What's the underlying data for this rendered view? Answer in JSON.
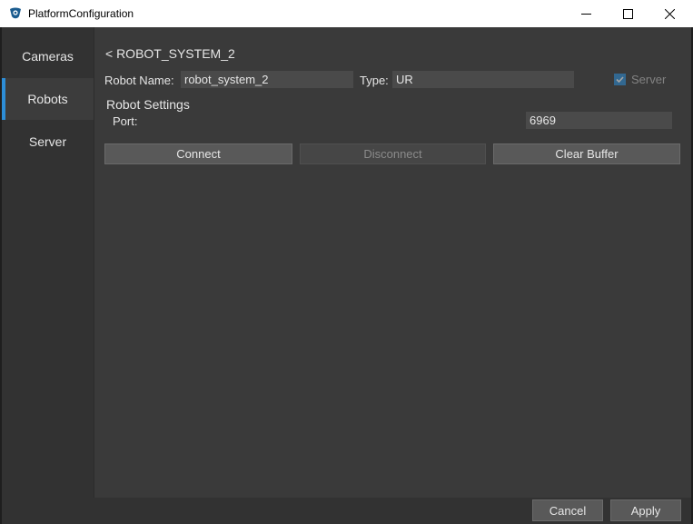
{
  "window": {
    "title": "PlatformConfiguration",
    "controls": {
      "minimize": "minimize-icon",
      "maximize": "maximize-icon",
      "close": "close-icon"
    }
  },
  "sidebar": {
    "items": [
      {
        "label": "Cameras",
        "active": false
      },
      {
        "label": "Robots",
        "active": true
      },
      {
        "label": "Server",
        "active": false
      }
    ]
  },
  "main": {
    "back_link": "< ROBOT_SYSTEM_2",
    "robot_name_label": "Robot Name:",
    "robot_name_value": "robot_system_2",
    "type_label": "Type:",
    "type_value": "UR",
    "server_checkbox": {
      "label": "Server",
      "checked": true,
      "enabled": false
    },
    "settings_title": "Robot Settings",
    "port_label": "Port:",
    "port_value": "6969",
    "buttons": {
      "connect": "Connect",
      "disconnect": "Disconnect",
      "clear_buffer": "Clear Buffer"
    }
  },
  "footer": {
    "cancel": "Cancel",
    "apply": "Apply"
  },
  "colors": {
    "accent": "#2d8ed8",
    "background": "#3c3c3c",
    "sidebar": "#323232"
  }
}
